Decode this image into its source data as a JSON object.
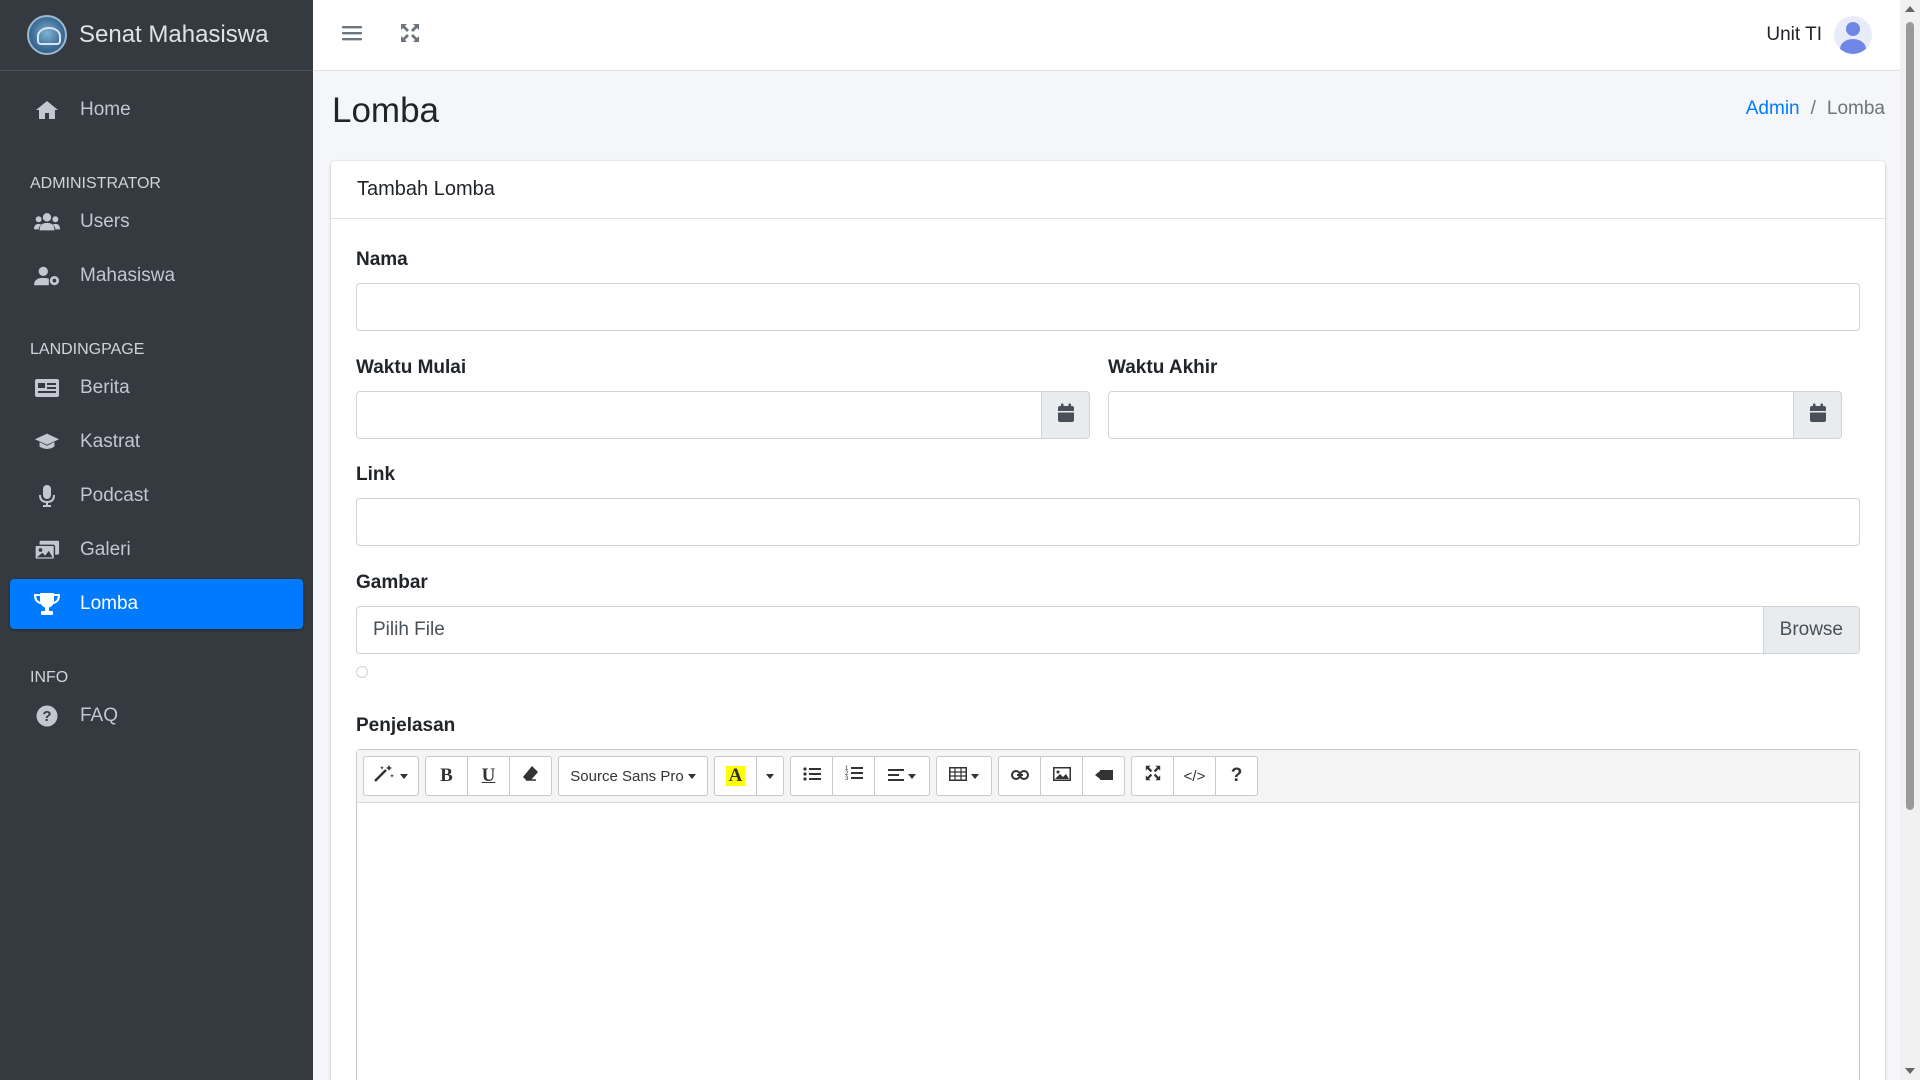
{
  "brand": {
    "title": "Senat Mahasiswa"
  },
  "sidebar": {
    "home": "Home",
    "sections": [
      {
        "header": "ADMINISTRATOR",
        "items": [
          "Users",
          "Mahasiswa"
        ]
      },
      {
        "header": "LANDINGPAGE",
        "items": [
          "Berita",
          "Kastrat",
          "Podcast",
          "Galeri",
          "Lomba"
        ]
      },
      {
        "header": "INFO",
        "items": [
          "FAQ"
        ]
      }
    ],
    "active": "Lomba"
  },
  "topbar": {
    "user": "Unit TI"
  },
  "page": {
    "title": "Lomba"
  },
  "breadcrumb": {
    "root": "Admin",
    "current": "Lomba"
  },
  "card": {
    "title": "Tambah Lomba"
  },
  "form": {
    "nama_label": "Nama",
    "waktu_mulai_label": "Waktu Mulai",
    "waktu_akhir_label": "Waktu Akhir",
    "link_label": "Link",
    "gambar_label": "Gambar",
    "file_placeholder": "Pilih File",
    "browse_label": "Browse",
    "penjelasan_label": "Penjelasan"
  },
  "editor": {
    "font_name": "Source Sans Pro",
    "bold": "B",
    "underline": "U",
    "help": "?",
    "code": "</>",
    "highlight_color": "#ffff00"
  },
  "colors": {
    "accent": "#007bff",
    "sidebar_bg": "#343a40"
  }
}
